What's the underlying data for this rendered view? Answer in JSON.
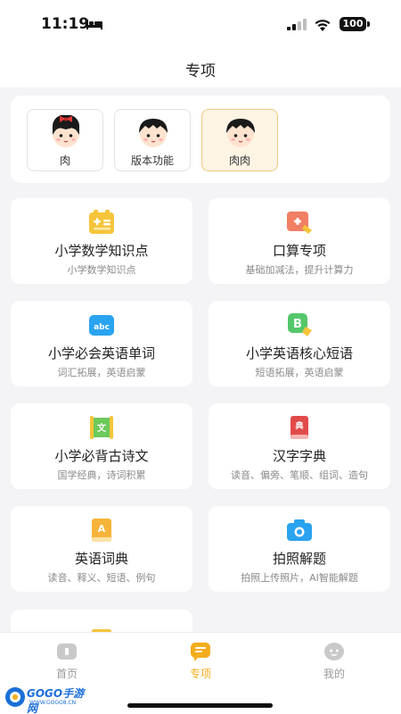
{
  "status_bar": {
    "time": "11:19",
    "battery": "100"
  },
  "header": {
    "title": "专项"
  },
  "profiles": [
    {
      "name": "肉",
      "selected": false
    },
    {
      "name": "版本功能",
      "selected": false
    },
    {
      "name": "肉肉",
      "selected": true
    }
  ],
  "features": [
    {
      "title": "小学数学知识点",
      "subtitle": "小学数学知识点",
      "icon": "calculator-icon",
      "color": "#f6c53a"
    },
    {
      "title": "口算专项",
      "subtitle": "基础加减法，提升计算力",
      "icon": "plus-card-icon",
      "color": "#f07f63"
    },
    {
      "title": "小学必会英语单词",
      "subtitle": "词汇拓展，英语启蒙",
      "icon": "abc-icon",
      "color": "#2aa3f0",
      "icon_text": "abc"
    },
    {
      "title": "小学英语核心短语",
      "subtitle": "短语拓展，英语启蒙",
      "icon": "b-bubble-icon",
      "color": "#55c76b",
      "icon_text": "B"
    },
    {
      "title": "小学必背古诗文",
      "subtitle": "国学经典，诗词积累",
      "icon": "scroll-icon",
      "color": "#6cc95a",
      "icon_text": "文"
    },
    {
      "title": "汉字字典",
      "subtitle": "读音、偏旁、笔顺、组词、造句",
      "icon": "dictionary-icon",
      "color": "#e24a4a",
      "icon_text": "典"
    },
    {
      "title": "英语词典",
      "subtitle": "读音、释义、短语、例句",
      "icon": "a-book-icon",
      "color": "#f7b43a",
      "icon_text": "A"
    },
    {
      "title": "拍照解题",
      "subtitle": "拍照上传照片，AI智能解题",
      "icon": "camera-icon",
      "color": "#2aa3f0"
    }
  ],
  "tabs": [
    {
      "label": "首页",
      "icon": "home-icon",
      "active": false
    },
    {
      "label": "专项",
      "icon": "special-icon",
      "active": true
    },
    {
      "label": "我的",
      "icon": "profile-icon",
      "active": false
    }
  ],
  "watermark": {
    "text": "GOGO手游网",
    "sub": "WWW.GOGO8.CN"
  },
  "colors": {
    "accent": "#f3ad1c",
    "selected_bg": "#fdf4e4"
  }
}
